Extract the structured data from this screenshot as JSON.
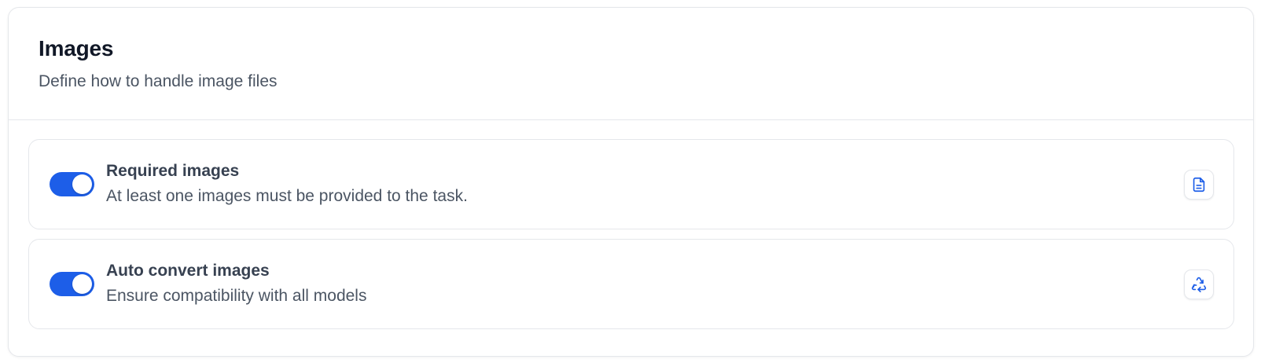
{
  "section": {
    "title": "Images",
    "subtitle": "Define how to handle image files"
  },
  "options": [
    {
      "title": "Required images",
      "description": "At least one images must be provided to the task.",
      "enabled": true,
      "icon": "document-icon"
    },
    {
      "title": "Auto convert images",
      "description": "Ensure compatibility with all models",
      "enabled": true,
      "icon": "recycle-icon"
    }
  ],
  "colors": {
    "accent": "#1d5ee8",
    "title_text": "#111827",
    "body_text": "#4b5563",
    "border": "#e5e7eb"
  }
}
